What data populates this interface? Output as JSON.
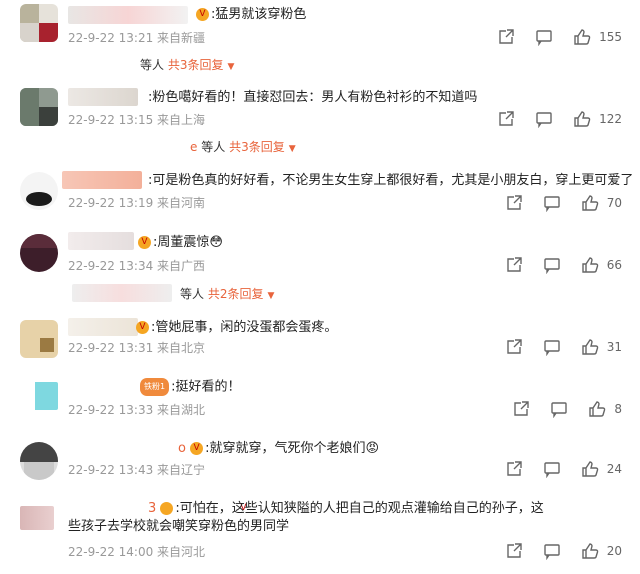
{
  "comments": [
    {
      "text": ":猛男就该穿粉色",
      "time": "22-9-22 13:21 来自新疆",
      "likes": "155",
      "reply": {
        "suffix": "等人",
        "more": "共3条回复"
      }
    },
    {
      "text": ":粉色噶好看的！直接怼回去：男人有粉色衬衫的不知道吗",
      "time": "22-9-22 13:15 来自上海",
      "likes": "122",
      "reply": {
        "prefix": "e",
        "suffix": "等人",
        "more": "共3条回复"
      }
    },
    {
      "text": ":可是粉色真的好好看，不论男生女生穿上都很好看，尤其是小朋友白，穿上更可爱了",
      "time": "22-9-22 13:19 来自河南",
      "likes": "70"
    },
    {
      "text": ":周董震惊",
      "emoji": "😳",
      "time": "22-9-22 13:34 来自广西",
      "likes": "66",
      "reply": {
        "suffix": "等人",
        "more": "共2条回复"
      }
    },
    {
      "text": ":管她屁事，闲的没蛋都会蛋疼。",
      "time": "22-9-22 13:31 来自北京",
      "likes": "31"
    },
    {
      "badge": "铁粉1",
      "text": ":挺好看的！",
      "time": "22-9-22 13:33 来自湖北",
      "likes": "8"
    },
    {
      "prefix": "o",
      "text": ":就穿就穿，气死你个老娘们",
      "emoji": "😡",
      "time": "22-9-22 13:43 来自辽宁",
      "likes": "24"
    },
    {
      "prefix": "3",
      "text": ":可怕在，这些认知狭隘的人把自己的观点灌输给自己的孙子，这些孩子去学校就会嘲笑穿粉色的男同学",
      "time": "22-9-22 14:00 来自河北",
      "likes": "20"
    }
  ],
  "colors": {
    "accent": "#e8643c",
    "meta": "#999999",
    "vbadge": "#f5a623"
  },
  "icons": {
    "share": "share-icon",
    "comment": "comment-icon",
    "like": "thumbs-up-icon",
    "verified": "vip-badge-icon"
  }
}
